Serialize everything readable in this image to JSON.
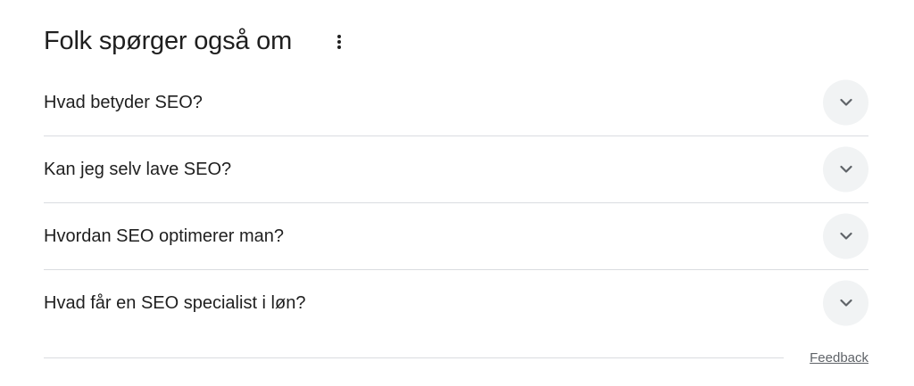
{
  "section": {
    "title": "Folk spørger også om",
    "more_icon": "more-vert-icon"
  },
  "questions": [
    {
      "text": "Hvad betyder SEO?",
      "icon": "chevron-down-icon"
    },
    {
      "text": "Kan jeg selv lave SEO?",
      "icon": "chevron-down-icon"
    },
    {
      "text": "Hvordan SEO optimerer man?",
      "icon": "chevron-down-icon"
    },
    {
      "text": "Hvad får en SEO specialist i løn?",
      "icon": "chevron-down-icon"
    }
  ],
  "footer": {
    "feedback_label": "Feedback"
  },
  "colors": {
    "text": "#1f1f1f",
    "divider": "#dadce0",
    "chevron_bg": "#f1f3f4",
    "chevron": "#5f6368",
    "muted": "#5f6368"
  }
}
